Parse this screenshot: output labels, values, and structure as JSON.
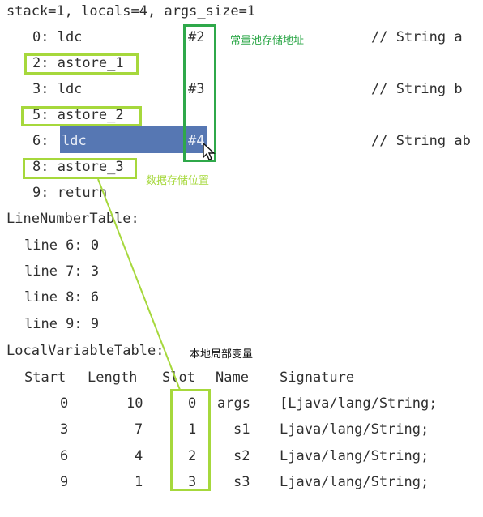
{
  "header": {
    "text": "stack=1, locals=4, args_size=1"
  },
  "instructions": [
    {
      "offset_label": "0: ldc",
      "operand": "#2",
      "comment": "// String a"
    },
    {
      "offset_label": "2: astore_1"
    },
    {
      "offset_label": "3: ldc",
      "operand": "#3",
      "comment": "// String b"
    },
    {
      "offset_label": "5: astore_2"
    },
    {
      "offset_label_prefix": "6:",
      "offset_label_op": "ldc",
      "operand": "#4",
      "comment": "// String ab"
    },
    {
      "offset_label": "8: astore_3"
    },
    {
      "offset_label": "9: return"
    }
  ],
  "annotations": {
    "constant_pool": "常量池存储地址",
    "storage_location": "数据存储位置",
    "local_variables": "本地局部变量"
  },
  "line_number_table": {
    "title": "LineNumberTable:",
    "rows": [
      "line 6: 0",
      "line 7: 3",
      "line 8: 6",
      "line 9: 9"
    ]
  },
  "local_variable_table": {
    "title": "LocalVariableTable:",
    "headers": [
      "Start",
      "Length",
      "Slot",
      "Name",
      "Signature"
    ],
    "rows": [
      [
        "0",
        "10",
        "0",
        "args",
        "[Ljava/lang/String;"
      ],
      [
        "3",
        "7",
        "1",
        "s1",
        "Ljava/lang/String;"
      ],
      [
        "6",
        "4",
        "2",
        "s2",
        "Ljava/lang/String;"
      ],
      [
        "9",
        "1",
        "3",
        "s3",
        "Ljava/lang/String;"
      ]
    ]
  },
  "colors": {
    "text": "#2f2f2f",
    "lime_green": "#a6d83c",
    "dark_green": "#2fa84a",
    "selection": "#5677b3"
  },
  "icons": [
    "mouse-pointer-icon"
  ]
}
